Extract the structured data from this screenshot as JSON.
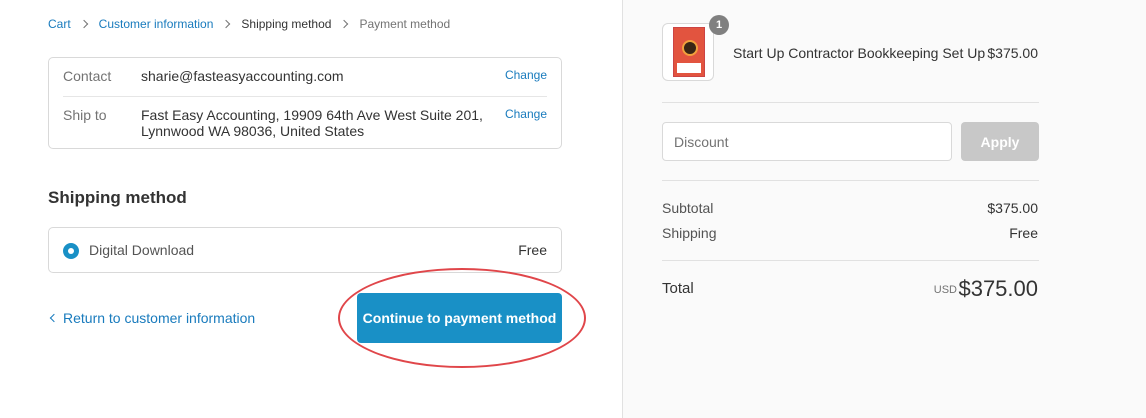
{
  "breadcrumb": {
    "items": [
      {
        "label": "Cart"
      },
      {
        "label": "Customer information"
      },
      {
        "label": "Shipping method"
      },
      {
        "label": "Payment method"
      }
    ]
  },
  "review": {
    "contact": {
      "label": "Contact",
      "value": "sharie@fasteasyaccounting.com",
      "change": "Change"
    },
    "ship_to": {
      "label": "Ship to",
      "line1": "Fast Easy Accounting, 19909 64th Ave West Suite 201,",
      "line2": "Lynnwood WA 98036, United States",
      "change": "Change"
    }
  },
  "shipping": {
    "title": "Shipping method",
    "option_label": "Digital Download",
    "option_price": "Free"
  },
  "actions": {
    "return_label": "Return to customer information",
    "continue_label": "Continue to payment method"
  },
  "order": {
    "product": {
      "name": "Start Up Contractor Bookkeeping Set Up",
      "price": "$375.00",
      "quantity": "1"
    },
    "discount": {
      "placeholder": "Discount",
      "apply_label": "Apply"
    },
    "subtotal": {
      "label": "Subtotal",
      "value": "$375.00"
    },
    "shipping": {
      "label": "Shipping",
      "value": "Free"
    },
    "total": {
      "label": "Total",
      "currency": "USD",
      "value": "$375.00"
    }
  },
  "colors": {
    "accent": "#1990c6",
    "link": "#197bbd",
    "annotation": "#e0464a",
    "sidebar_bg": "#fafafa"
  },
  "icons": [
    "chevron-right-icon",
    "chevron-left-icon",
    "radio-selected-icon",
    "product-thumbnail"
  ]
}
